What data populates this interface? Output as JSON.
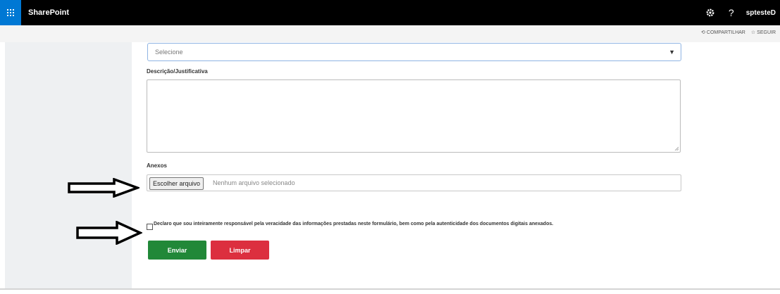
{
  "header": {
    "brand": "SharePoint",
    "user": "sptesteD",
    "help_label": "?"
  },
  "actions": {
    "share_label": "COMPARTILHAR",
    "follow_label": "SEGUIR"
  },
  "form": {
    "select_value": "Selecione",
    "description_label": "Descrição/Justificativa",
    "attachments_label": "Anexos",
    "file_button_label": "Escolher arquivo",
    "file_status": "Nenhum arquivo selecionado",
    "declaration": "Declaro que sou inteiramente responsável pela veracidade das informações prestadas neste formulário, bem como pela autenticidade dos documentos digitais anexados.",
    "submit_label": "Enviar",
    "clear_label": "Limpar"
  }
}
